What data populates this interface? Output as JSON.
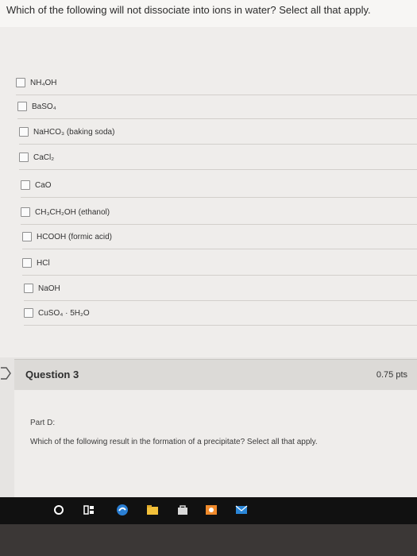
{
  "question2": {
    "prompt": "Which of the following will not dissociate into ions in water? Select all that apply.",
    "options": [
      {
        "label": "NH₄OH"
      },
      {
        "label": "BaSO₄"
      },
      {
        "label": "NaHCO₃ (baking soda)"
      },
      {
        "label": "CaCl₂"
      },
      {
        "label": "CaO"
      },
      {
        "label": "CH₃CH₂OH (ethanol)"
      },
      {
        "label": "HCOOH (formic acid)"
      },
      {
        "label": "HCl"
      },
      {
        "label": "NaOH"
      },
      {
        "label": "CuSO₄ · 5H₂O"
      }
    ]
  },
  "question3": {
    "title": "Question 3",
    "points": "0.75 pts",
    "part": "Part D:",
    "prompt": "Which of the following result in the formation of a precipitate? Select all that apply."
  },
  "taskbar": {
    "icons": [
      "cortana-icon",
      "task-view-icon",
      "edge-icon",
      "file-explorer-icon",
      "store-icon",
      "photo-app-icon",
      "mail-icon"
    ]
  }
}
